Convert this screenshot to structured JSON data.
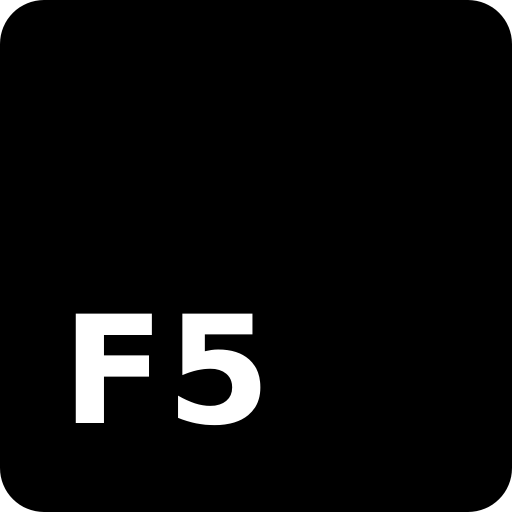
{
  "key": {
    "label": "F5",
    "background_color": "#000000",
    "text_color": "#ffffff"
  }
}
